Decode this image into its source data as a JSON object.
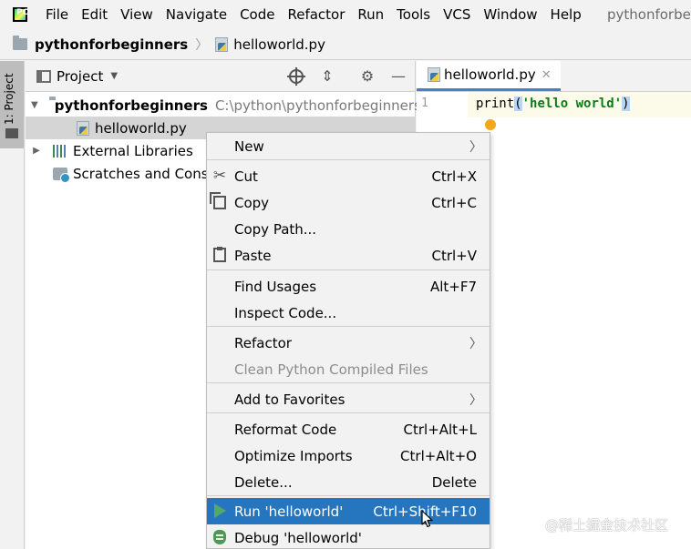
{
  "menubar": {
    "items": [
      {
        "label": "File"
      },
      {
        "label": "Edit"
      },
      {
        "label": "View"
      },
      {
        "label": "Navigate"
      },
      {
        "label": "Code"
      },
      {
        "label": "Refactor"
      },
      {
        "label": "Run"
      },
      {
        "label": "Tools"
      },
      {
        "label": "VCS"
      },
      {
        "label": "Window"
      },
      {
        "label": "Help"
      }
    ],
    "window_title": "pythonforbeginners"
  },
  "navbar": {
    "project": "pythonforbeginners",
    "file": "helloworld.py"
  },
  "left_stripe": {
    "tab_label": "1: Project"
  },
  "project_panel": {
    "title": "Project",
    "tree": {
      "root_name": "pythonforbeginners",
      "root_path": "C:\\python\\pythonforbeginners",
      "file_name": "helloworld.py",
      "libs_name": "External Libraries",
      "scratch_name": "Scratches and Consoles"
    }
  },
  "editor": {
    "tab_label": "helloworld.py",
    "line_number": "1",
    "code_func": "print",
    "code_open": "(",
    "code_string": "'hello world'",
    "code_close": ")"
  },
  "context_menu": {
    "new": "New",
    "cut": "Cut",
    "cut_shortcut": "Ctrl+X",
    "copy": "Copy",
    "copy_shortcut": "Ctrl+C",
    "copy_path": "Copy Path...",
    "paste": "Paste",
    "paste_shortcut": "Ctrl+V",
    "find_usages": "Find Usages",
    "find_usages_shortcut": "Alt+F7",
    "inspect_code": "Inspect Code...",
    "refactor": "Refactor",
    "clean_compiled": "Clean Python Compiled Files",
    "add_favorites": "Add to Favorites",
    "reformat": "Reformat Code",
    "reformat_shortcut": "Ctrl+Alt+L",
    "optimize": "Optimize Imports",
    "optimize_shortcut": "Ctrl+Alt+O",
    "delete": "Delete...",
    "delete_shortcut": "Delete",
    "run": "Run 'helloworld'",
    "run_shortcut": "Ctrl+Shift+F10",
    "debug": "Debug 'helloworld'"
  },
  "watermark": "@稀土掘金技术社区",
  "colors": {
    "selection": "#2675bf",
    "tab_accent": "#4083c9",
    "run_icon": "#54a86a",
    "string": "#067d17"
  }
}
